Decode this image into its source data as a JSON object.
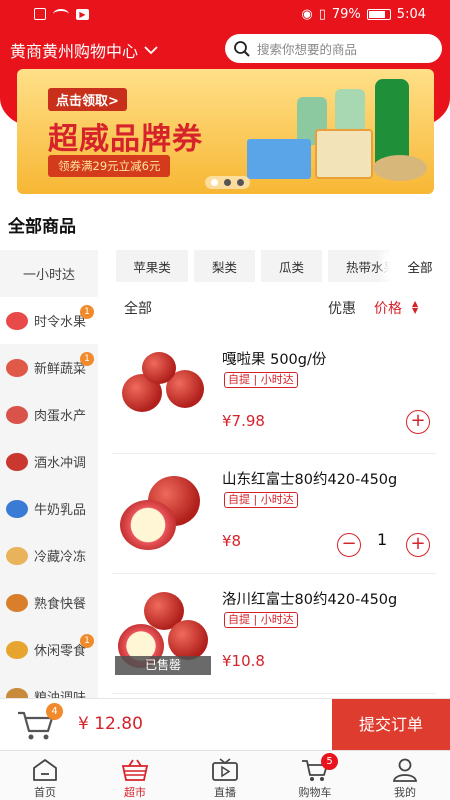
{
  "status": {
    "battery": "79%",
    "time": "5:04"
  },
  "header": {
    "store_name": "黄商黄州购物中心",
    "search_placeholder": "搜索你想要的商品"
  },
  "banner": {
    "claim": "点击领取>",
    "title": "超威品牌券",
    "subtitle": "领券满29元立减6元"
  },
  "section_title": "全部商品",
  "sidebar": {
    "items": [
      {
        "label": "一小时达",
        "badge": "",
        "icon": "clock"
      },
      {
        "label": "时令水果",
        "badge": "1",
        "icon": "fruit-icon",
        "color": "#e84a4a"
      },
      {
        "label": "新鲜蔬菜",
        "badge": "1",
        "icon": "vegetable-icon",
        "color": "#e05848"
      },
      {
        "label": "肉蛋水产",
        "badge": "",
        "icon": "meat-icon",
        "color": "#d9534a"
      },
      {
        "label": "酒水冲调",
        "badge": "",
        "icon": "drink-icon",
        "color": "#c9372f"
      },
      {
        "label": "牛奶乳品",
        "badge": "",
        "icon": "milk-icon",
        "color": "#3a7bd5"
      },
      {
        "label": "冷藏冷冻",
        "badge": "",
        "icon": "frozen-icon",
        "color": "#e8b35a"
      },
      {
        "label": "熟食快餐",
        "badge": "",
        "icon": "deli-icon",
        "color": "#d97e2b"
      },
      {
        "label": "休闲零食",
        "badge": "1",
        "icon": "snack-icon",
        "color": "#e7a52f"
      },
      {
        "label": "粮油调味",
        "badge": "",
        "icon": "grain-icon",
        "color": "#c98a3a"
      }
    ]
  },
  "tabs": [
    "苹果类",
    "梨类",
    "瓜类",
    "热带水果"
  ],
  "tab_all": "全部",
  "sort": {
    "all": "全部",
    "discount": "优惠",
    "price": "价格"
  },
  "products": [
    {
      "name": "嘎啦果 500g/份",
      "tags": "自提 | 小时达",
      "price": "¥7.98",
      "qty": "",
      "sold_out": ""
    },
    {
      "name": "山东红富士80约420-450g",
      "tags": "自提 | 小时达",
      "price": "¥8",
      "qty": "1",
      "sold_out": ""
    },
    {
      "name": "洛川红富士80约420-450g",
      "tags": "自提 | 小时达",
      "price": "¥10.8",
      "qty": "",
      "sold_out": "已售罄"
    }
  ],
  "cart": {
    "badge": "4",
    "total": "¥ 12.80",
    "submit": "提交订单"
  },
  "nav": [
    {
      "label": "首页",
      "icon": "home-icon",
      "badge": ""
    },
    {
      "label": "超市",
      "icon": "basket-icon",
      "badge": "",
      "active": true
    },
    {
      "label": "直播",
      "icon": "tv-icon",
      "badge": ""
    },
    {
      "label": "购物车",
      "icon": "cart-icon",
      "badge": "5"
    },
    {
      "label": "我的",
      "icon": "user-icon",
      "badge": ""
    }
  ],
  "colors": {
    "primary": "#e8131b",
    "accent": "#d6232b",
    "badge": "#f08a2b"
  }
}
